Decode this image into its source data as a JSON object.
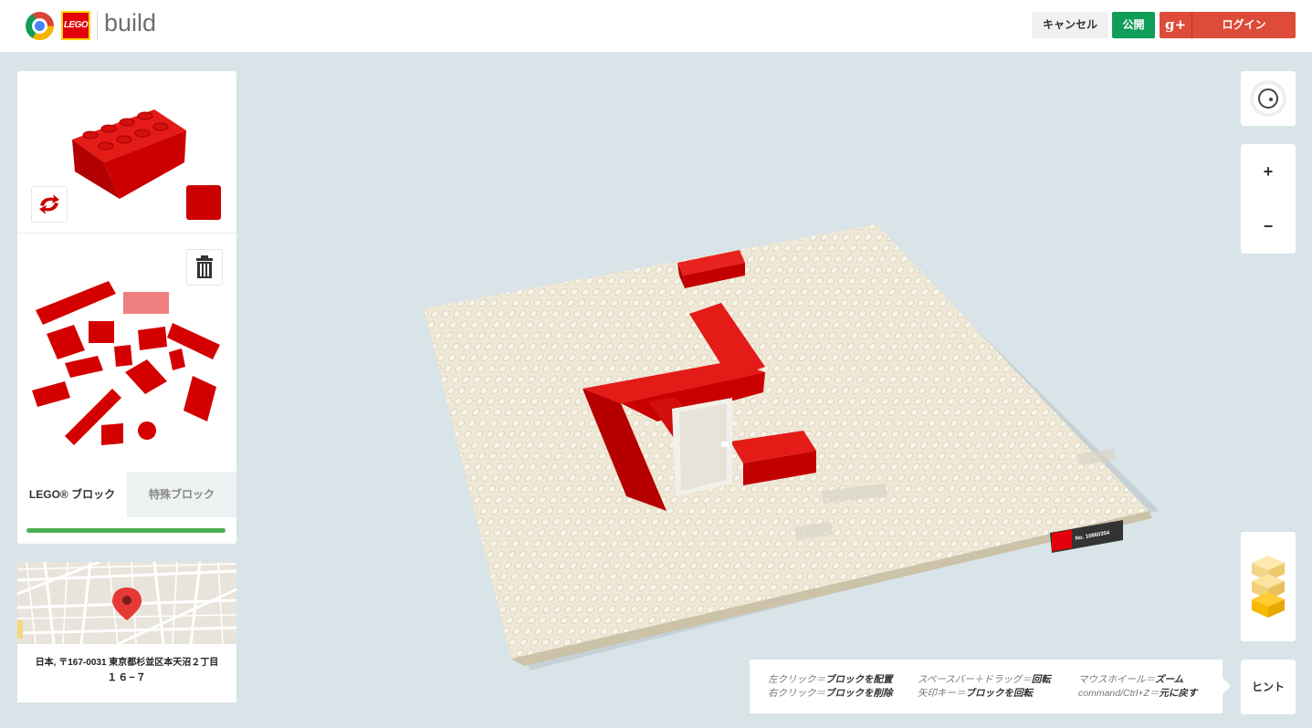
{
  "header": {
    "brand_lego": "LEGO",
    "brand_text": "build",
    "cancel_label": "キャンセル",
    "publish_label": "公開",
    "gplus_label": "g+",
    "login_label": "ログイン"
  },
  "palette": {
    "selected_color": "#cc0000",
    "tabs": [
      {
        "label": "LEGO® ブロック",
        "active": true
      },
      {
        "label": "特殊ブロック",
        "active": false
      }
    ],
    "progress": 1.0
  },
  "map": {
    "address_line1": "日本, 〒167-0031 東京都杉並区本天沼２丁目",
    "address_line2": "１６−７"
  },
  "controls": {
    "zoom_in": "+",
    "zoom_out": "−",
    "hint_label": "ヒント"
  },
  "hints": {
    "c1_l1_key": "左クリック＝",
    "c1_l1_act": "ブロックを配置",
    "c1_l2_key": "右クリック＝",
    "c1_l2_act": "ブロックを削除",
    "c2_l1_key": "スペースバー＋ドラッグ＝",
    "c2_l1_act": "回転",
    "c2_l2_key": "矢印キー＝",
    "c2_l2_act": "ブロックを回転",
    "c3_l1_key": "マウスホイール＝",
    "c3_l1_act": "ズーム",
    "c3_l2_key": "command/Ctrl+Z＝",
    "c3_l2_act": "元に戻す"
  },
  "baseplate": {
    "label_brand": "LEGO",
    "label_number": "No. 10860354"
  },
  "colors": {
    "brick_red": "#cc0000",
    "baseplate": "#efe8d6",
    "publish_green": "#0f9d58",
    "login_red": "#dd4b39"
  }
}
